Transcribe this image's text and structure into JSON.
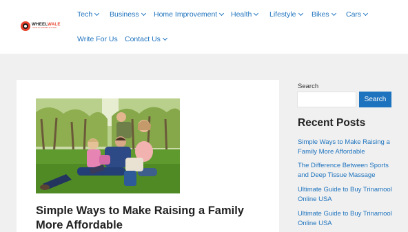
{
  "brand": {
    "logo_name_a": "WHEEL",
    "logo_name_b": "WALE",
    "logo_tagline": "YOUR AUTOMOBILE GUIDE"
  },
  "nav": {
    "items": [
      {
        "label": "Tech",
        "dropdown": true
      },
      {
        "label": "Business",
        "dropdown": true
      },
      {
        "label": "Home Improvement",
        "dropdown": true
      },
      {
        "label": "Health",
        "dropdown": true
      },
      {
        "label": "Lifestyle",
        "dropdown": true
      },
      {
        "label": "Bikes",
        "dropdown": true
      },
      {
        "label": "Cars",
        "dropdown": true
      },
      {
        "label": "Write For Us",
        "dropdown": false
      },
      {
        "label": "Contact Us",
        "dropdown": true
      }
    ]
  },
  "main": {
    "post": {
      "title": "Simple Ways to Make Raising a Family More Affordable"
    }
  },
  "sidebar": {
    "search": {
      "label": "Search",
      "value": "",
      "placeholder": "",
      "button_label": "Search"
    },
    "recent_posts": {
      "heading": "Recent Posts",
      "items": [
        {
          "title": "Simple Ways to Make Raising a Family More Affordable"
        },
        {
          "title": "The Difference Between Sports and Deep Tissue Massage"
        },
        {
          "title": "Ultimate Guide to Buy Trinamool Online USA"
        },
        {
          "title": "Ultimate Guide to Buy Trinamool Online USA"
        }
      ]
    }
  },
  "colors": {
    "accent": "#1e73be",
    "logo_red": "#e8402a",
    "page_background": "#f0f0f0"
  },
  "icons": {
    "nav_dropdown": "chevron-down-icon"
  }
}
